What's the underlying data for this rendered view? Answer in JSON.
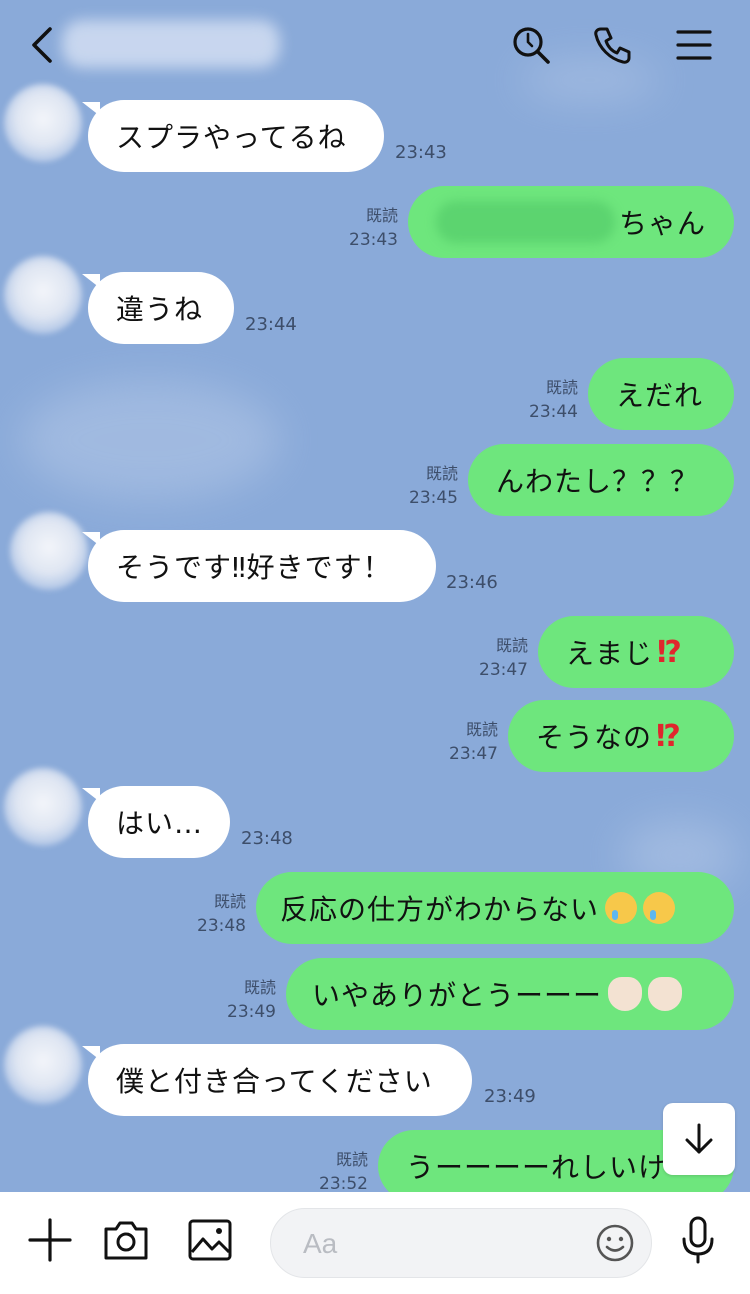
{
  "header": {
    "back_icon": "chevron-left-icon",
    "title": "",
    "icons": [
      "search-icon",
      "phone-icon",
      "menu-icon"
    ]
  },
  "read_label": "既読",
  "messages": [
    {
      "side": "in",
      "text": "スプラやってるね",
      "time": "23:43"
    },
    {
      "side": "out",
      "text": "ちゃん",
      "time": "23:43",
      "read": true,
      "note": "name redacted (blurred)"
    },
    {
      "side": "in",
      "text": "違うね",
      "time": "23:44"
    },
    {
      "side": "out",
      "text": "えだれ",
      "time": "23:44",
      "read": true
    },
    {
      "side": "out",
      "text": "んわたし？？？",
      "time": "23:45",
      "read": true
    },
    {
      "side": "in",
      "text": "そうです‼好きです！",
      "time": "23:46"
    },
    {
      "side": "out",
      "text": "えまじ",
      "emoji": "⁉",
      "time": "23:47",
      "read": true
    },
    {
      "side": "out",
      "text": "そうなの",
      "emoji": "⁉",
      "time": "23:47",
      "read": true
    },
    {
      "side": "in",
      "text": "はい…",
      "time": "23:48"
    },
    {
      "side": "out",
      "text": "反応の仕方がわからない",
      "emoji_icons": [
        "face-holding-back-tears-icon",
        "face-holding-back-tears-icon"
      ],
      "time": "23:48",
      "read": true
    },
    {
      "side": "out",
      "text": "いやありがとうーーー",
      "emoji_icons": [
        "call-me-hand-icon",
        "call-me-hand-icon"
      ],
      "time": "23:49",
      "read": true
    },
    {
      "side": "in",
      "text": "僕と付き合ってください",
      "time": "23:49"
    },
    {
      "side": "out",
      "text": "うーーーーれしいけ",
      "time": "23:52",
      "read": true
    }
  ],
  "scroll_button_icon": "arrow-down-icon",
  "input": {
    "placeholder": "Aa",
    "value": ""
  },
  "bottom_icons": [
    "plus-icon",
    "camera-icon",
    "image-icon",
    "emoji-icon",
    "microphone-icon"
  ],
  "colors": {
    "background": "#8aaad9",
    "bubble_out": "#6ee67d",
    "bubble_in": "#ffffff"
  }
}
